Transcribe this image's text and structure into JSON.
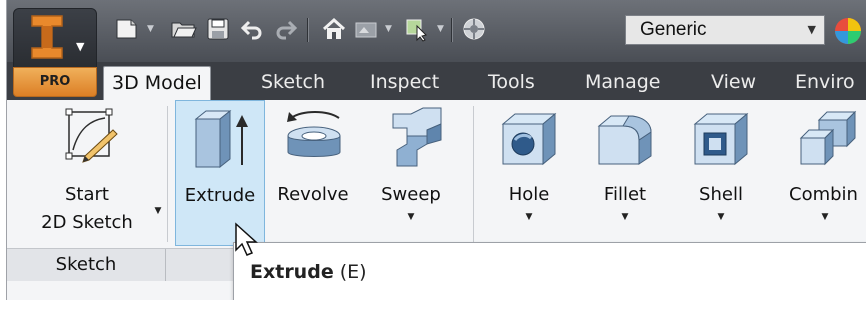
{
  "app": {
    "edition_badge": "PRO"
  },
  "quick_access": {
    "style_select": {
      "value": "Generic"
    }
  },
  "tabs": [
    {
      "label": "3D Model",
      "active": true
    },
    {
      "label": "Sketch"
    },
    {
      "label": "Inspect"
    },
    {
      "label": "Tools"
    },
    {
      "label": "Manage"
    },
    {
      "label": "View"
    },
    {
      "label": "Enviro"
    }
  ],
  "ribbon": {
    "start_sketch": {
      "line1": "Start",
      "line2": "2D Sketch"
    },
    "extrude": {
      "label": "Extrude"
    },
    "revolve": {
      "label": "Revolve"
    },
    "sweep": {
      "label": "Sweep"
    },
    "hole": {
      "label": "Hole"
    },
    "fillet": {
      "label": "Fillet"
    },
    "shell": {
      "label": "Shell"
    },
    "combine": {
      "label": "Combin"
    }
  },
  "panels": {
    "sketch": "Sketch"
  },
  "tooltip": {
    "title": "Extrude",
    "shortcut": "(E)"
  },
  "colors": {
    "accent_orange": "#dc7f25",
    "tab_bar": "#3b3e44",
    "highlight": "#cfe7f7"
  }
}
